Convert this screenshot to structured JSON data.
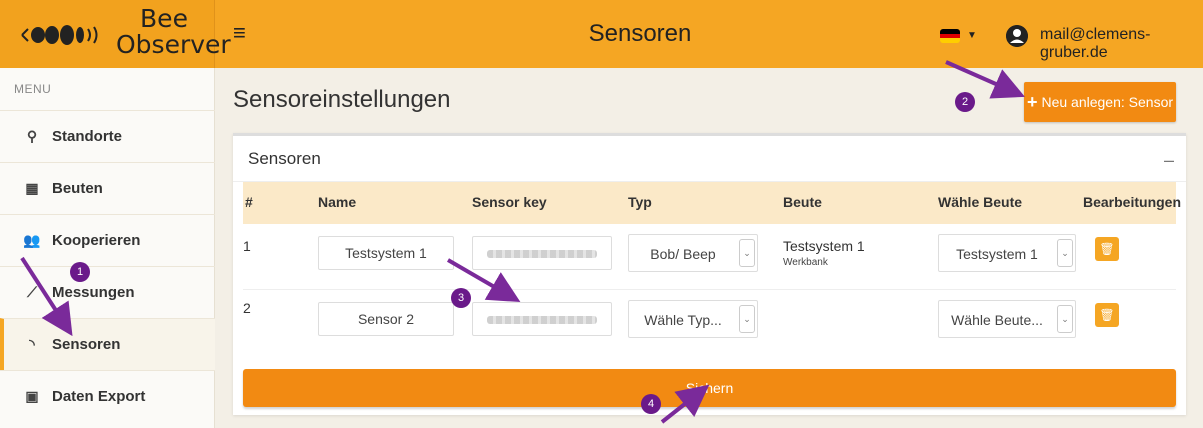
{
  "header": {
    "logo_line1": "Bee",
    "logo_line2": "Observer",
    "title": "Sensoren",
    "user_email": "mail@clemens-gruber.de",
    "menu_icon": "hamburger-icon"
  },
  "sidebar": {
    "menu_label": "MENU",
    "items": [
      {
        "label": "Standorte",
        "icon": "map-marker-icon",
        "glyph": "⚲"
      },
      {
        "label": "Beuten",
        "icon": "hive-icon",
        "glyph": "▦"
      },
      {
        "label": "Kooperieren",
        "icon": "users-icon",
        "glyph": "👥"
      },
      {
        "label": "Messungen",
        "icon": "chart-line-icon",
        "glyph": "⟋"
      },
      {
        "label": "Sensoren",
        "icon": "rss-icon",
        "glyph": "◝"
      },
      {
        "label": "Daten Export",
        "icon": "file-export-icon",
        "glyph": "▣"
      }
    ],
    "active": "Sensoren"
  },
  "main": {
    "title": "Sensoreinstellungen",
    "new_button": {
      "plus": "+",
      "label": "Neu anlegen: Sensor"
    },
    "panel_title": "Sensoren",
    "collapse": "–",
    "columns": [
      "#",
      "Name",
      "Sensor key",
      "Typ",
      "Beute",
      "Wähle Beute",
      "Bearbeitungen"
    ],
    "rows": [
      {
        "num": "1",
        "name": "Testsystem 1",
        "type": "Bob/ Beep",
        "beute": "Testsystem 1",
        "beute_sub": "Werkbank",
        "select_beute": "Testsystem 1"
      },
      {
        "num": "2",
        "name": "Sensor 2",
        "type": "Wähle Typ...",
        "beute": "",
        "beute_sub": "",
        "select_beute": "Wähle Beute..."
      }
    ],
    "save_label": "Sichern"
  },
  "annotations": [
    "1",
    "2",
    "3",
    "4"
  ],
  "colors": {
    "header": "#f5a623",
    "button": "#f28a12",
    "table_header": "#fbe9c8",
    "annotation": "#6a1a8a"
  }
}
